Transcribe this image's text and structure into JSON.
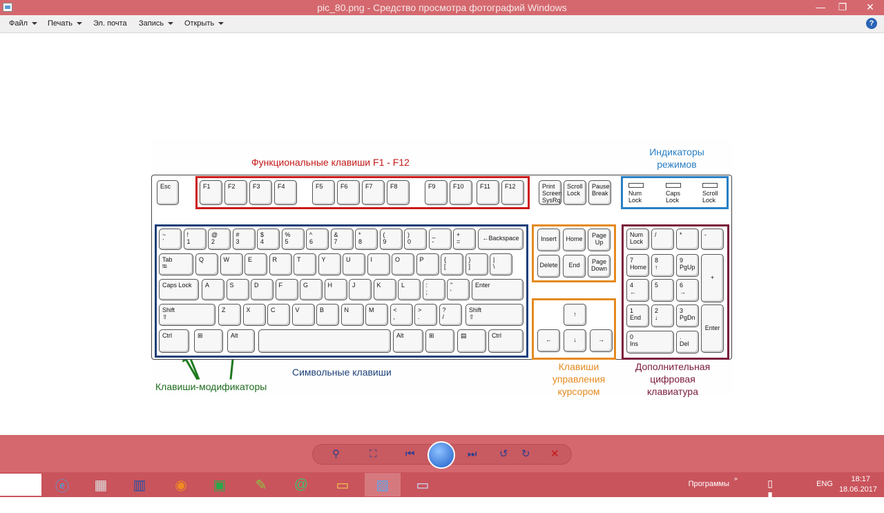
{
  "window": {
    "title": "pic_80.png - Средство просмотра фотографий Windows",
    "minimize": "—",
    "maximize": "❐",
    "close": "✕"
  },
  "menu": {
    "file": "Файл",
    "print": "Печать",
    "email": "Эл. почта",
    "burn": "Запись",
    "open": "Открыть",
    "help": "?"
  },
  "image_labels": {
    "function_keys": "Функциональные клавиши F1 - F12",
    "indicators": "Индикаторы\nрежимов",
    "symbol_keys": "Символьные клавиши",
    "modifier_keys": "Клавиши-модификаторы",
    "cursor_keys": "Клавиши\nуправления\nкурсором",
    "numpad": "Дополнительная\nцифровая\nклавиатура"
  },
  "keyboard": {
    "esc": "Esc",
    "fkeys": [
      "F1",
      "F2",
      "F3",
      "F4",
      "F5",
      "F6",
      "F7",
      "F8",
      "F9",
      "F10",
      "F11",
      "F12"
    ],
    "sys": [
      "Print\nScreen\nSysRq",
      "Scroll\nLock",
      "Pause\nBreak"
    ],
    "leds": [
      "Num\nLock",
      "Caps\nLock",
      "Scroll\nLock"
    ],
    "row1": [
      "~\n`",
      "!\n1",
      "@\n2",
      "#\n3",
      "$\n4",
      "%\n5",
      "^\n6",
      "&\n7",
      "*\n8",
      "(\n9",
      ")\n0",
      "_\n-",
      "+\n=",
      "←Backspace"
    ],
    "row2": [
      "Tab\n⭾",
      "Q",
      "W",
      "E",
      "R",
      "T",
      "Y",
      "U",
      "I",
      "O",
      "P",
      "{\n[",
      "}\n]",
      "|\n\\"
    ],
    "row3": [
      "Caps Lock",
      "A",
      "S",
      "D",
      "F",
      "G",
      "H",
      "J",
      "K",
      "L",
      ":\n;",
      "\"\n'",
      "Enter"
    ],
    "row4": [
      "Shift\n⇧",
      "Z",
      "X",
      "C",
      "V",
      "B",
      "N",
      "M",
      "<\n,",
      ">\n.",
      "?\n/",
      "Shift\n⇧"
    ],
    "row5": [
      "Ctrl",
      "⊞",
      "Alt",
      "",
      "Alt",
      "⊞",
      "▤",
      "Ctrl"
    ],
    "nav": [
      "Insert",
      "Home",
      "Page\nUp",
      "Delete",
      "End",
      "Page\nDown"
    ],
    "arrows": [
      "↑",
      "←",
      "↓",
      "→"
    ],
    "numpad": [
      "Num\nLock",
      "/",
      "*",
      "-",
      "7\nHome",
      "8\n↑",
      "9\nPgUp",
      "+",
      "4\n←",
      "5",
      "6\n→",
      "1\nEnd",
      "2\n↓",
      "3\nPgDn",
      "Enter",
      "0\nIns",
      ".\nDel"
    ]
  },
  "viewer_controls": {
    "zoom": "⚲",
    "fit": "⛶",
    "prev": "⏮",
    "next": "⏭",
    "rotate_ccw": "↺",
    "rotate_cw": "↻",
    "delete": "✕"
  },
  "taskbar": {
    "programs": "Программы",
    "lang": "ENG",
    "time": "18:17",
    "date": "18.06.2017"
  },
  "colors": {
    "titlebar": "#d4686e",
    "function_group": "#cc1a1a",
    "indicator_group": "#2a7fc4",
    "symbol_group": "#1c3f78",
    "cursor_group": "#e58a1f",
    "numpad_group": "#7a1a3a",
    "modifier_label": "#1f6b1f"
  }
}
